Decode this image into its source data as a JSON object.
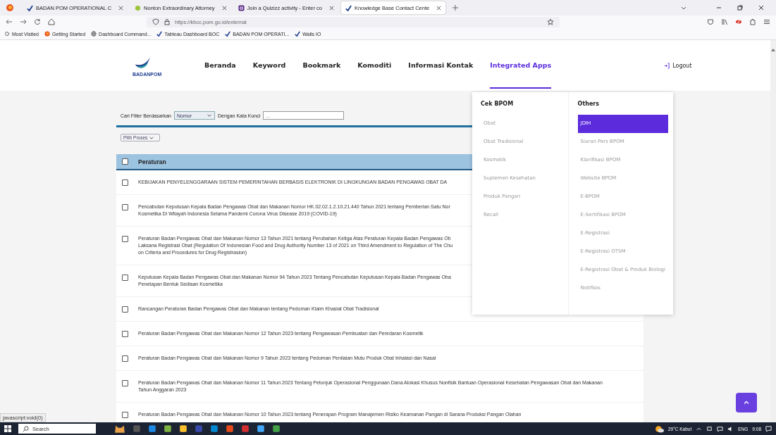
{
  "browser": {
    "tabs": [
      {
        "title": "BADAN POM OPERATIONAL C",
        "selected": false,
        "kind": "check"
      },
      {
        "title": "Nonton Extraordinary Attorney",
        "selected": false,
        "kind": "leaf"
      },
      {
        "title": "Join a Quizizz activity - Enter co",
        "selected": false,
        "kind": "quiz"
      },
      {
        "title": "Knowledge Base Contact Cente",
        "selected": true,
        "kind": "check"
      }
    ],
    "url": "https://kbcc.pom.go.id/external",
    "bookmarks": [
      {
        "label": "Most Visited",
        "kind": "gear"
      },
      {
        "label": "Getting Started",
        "kind": "fox"
      },
      {
        "label": "Dashboard Command...",
        "kind": "globe"
      },
      {
        "label": "Tableau Dashboard BOC",
        "kind": "check"
      },
      {
        "label": "BADAN POM OPERATI...",
        "kind": "check"
      },
      {
        "label": "Walls IO",
        "kind": "check"
      }
    ]
  },
  "header": {
    "logo_text": "BADANPOM",
    "nav": [
      {
        "label": "Beranda",
        "selected": false
      },
      {
        "label": "Keyword",
        "selected": false
      },
      {
        "label": "Bookmark",
        "selected": false
      },
      {
        "label": "Komoditi",
        "selected": false
      },
      {
        "label": "Informasi Kontak",
        "selected": false
      },
      {
        "label": "Integrated Apps",
        "selected": true
      }
    ],
    "logout": "Logout"
  },
  "filter": {
    "label": "Cari Filter Berdasarkan",
    "select_value": "Nomor",
    "keyword_label": "Dengan Kata Kunci",
    "keyword_placeholder": "...",
    "process_select": "Pilih Proses"
  },
  "table": {
    "header": {
      "label": "Peraturan",
      "checked": false
    },
    "rows": [
      {
        "checked": false,
        "lines": [
          "KEBIJAKAN PENYELENGGARAAN SISTEM PEMERINTAHAN BERBASIS ELEKTRONIK DI LINGKUNGAN BADAN PENGAWAS OBAT DA"
        ]
      },
      {
        "checked": false,
        "lines": [
          "Pencabutan Keputusan Kepala Badan Pengawas Obat dan Makanan Nomor HK.02.02.1.2.10.21.440 Tahun 2021 tentang Pemberian Satu Nor",
          "Kosmetika Di Wilayah Indonesia Selama Pandemi Corona Virus Disease 2019 (COVID-19)"
        ]
      },
      {
        "checked": false,
        "lines": [
          "Peraturan Badan Pengawas Obat dan Makanan Nomor 13 Tahun 2021 tentang Perubahan Ketiga Atas Peraturan Kepala Badan Pengawas Ob",
          "Laksana Registrasi Obat (Regulation Of Indonesian Food and Drug Authority Number 13 of 2021 on Third Amendment to Regulation of The Chu",
          "on Criteria and Procedures for Drug Registrasion)"
        ]
      },
      {
        "checked": false,
        "lines": [
          "Keputusan Kepala Badan Pengawas Obat dan Makanan Nomor 94 Tahun 2023 Tentang Pencabutan Keputusan Kepala Badan Pengawas Oba",
          "Penetapan Bentuk Sediaan Kosmetika"
        ]
      },
      {
        "checked": false,
        "lines": [
          "Rancangan Peraturan Badan Pengawas Obat dan Makanan tentang Pedoman Klaim Khasiat Obat Tradisional"
        ]
      },
      {
        "checked": false,
        "lines": [
          "Peraturan Badan Pengawas Obat dan Makanan Nomor 12 Tahun 2023 tentang Pengawasan Pembuatan dan Peredaran Kosmetik"
        ]
      },
      {
        "checked": false,
        "lines": [
          "Peraturan Badan Pengawas Obat dan Makanan Nomor 9 Tahun 2023 tentang Pedoman Penilaian Mutu Produk Obat Inhalasi dan Nasal"
        ]
      },
      {
        "checked": false,
        "lines": [
          "Peraturan Badan Pengawas Obat dan Makanan Nomor 11 Tahun 2023 Tentang Petunjuk Operasional Penggunaan Dana Alokasi Khusus Nonfisik Bantuan Operasional Kesehatan Pengawasan Obat dan Makanan",
          "Tahun Anggaran 2023"
        ]
      },
      {
        "checked": false,
        "lines": [
          "Peraturan Badan Pengawas Obat dan Makanan Nomor 10 Tahun 2023 tentang Penerapan Program Manajemen Risiko Keamanan Pangan di Sarana Produksi Pangan Olahan"
        ]
      }
    ]
  },
  "dropdown": {
    "columns": [
      {
        "title": "Cek BPOM",
        "items": [
          {
            "label": "Obat",
            "selected": false
          },
          {
            "label": "Obat Tradisional",
            "selected": false
          },
          {
            "label": "Kosmetik",
            "selected": false
          },
          {
            "label": "Suplemen Kesehatan",
            "selected": false
          },
          {
            "label": "Produk Pangan",
            "selected": false
          },
          {
            "label": "Recall",
            "selected": false
          }
        ]
      },
      {
        "title": "Others",
        "items": [
          {
            "label": "JDIH",
            "selected": true
          },
          {
            "label": "Siaran Pers BPOM",
            "selected": false
          },
          {
            "label": "Klarifikasi BPOM",
            "selected": false
          },
          {
            "label": "Website BPOM",
            "selected": false
          },
          {
            "label": "E-BPOM",
            "selected": false
          },
          {
            "label": "E-Sertifikasi BPOM",
            "selected": false
          },
          {
            "label": "E-Registrasi",
            "selected": false
          },
          {
            "label": "E-Registrasi OTSM",
            "selected": false
          },
          {
            "label": "E-Registrasi Obat & Produk Biologi",
            "selected": false
          },
          {
            "label": "Notifkos",
            "selected": false
          }
        ]
      }
    ]
  },
  "status_text": "javascript:void(0)",
  "taskbar": {
    "search": "Search",
    "weather": "29°C Kabut",
    "language": "ENG",
    "time": "9:08"
  }
}
